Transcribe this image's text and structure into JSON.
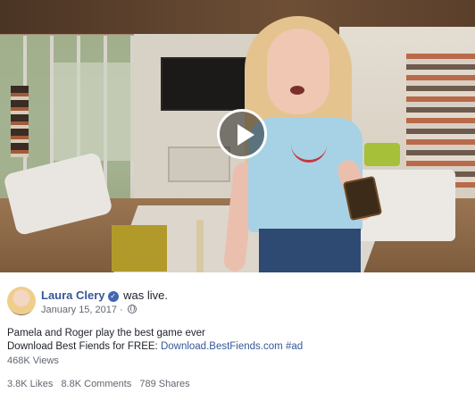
{
  "video": {
    "play_icon": "play-icon"
  },
  "post": {
    "author": "Laura Clery",
    "verified_icon": "check-badge-icon",
    "status": "was live.",
    "date": "January 15, 2017",
    "separator": "·",
    "privacy_icon": "globe-icon",
    "text_line1": "Pamela and Roger play the best game ever",
    "text_line2_prefix": "Download Best Fiends for FREE: ",
    "text_line2_link": "Download.BestFiends.com",
    "text_line2_hashtag": "#ad",
    "views": "468K Views",
    "likes": "3.8K Likes",
    "comments": "8.8K Comments",
    "shares": "789 Shares"
  },
  "colors": {
    "link": "#365899",
    "meta": "#616770",
    "text": "#1d2129",
    "verified": "#4267b2"
  }
}
